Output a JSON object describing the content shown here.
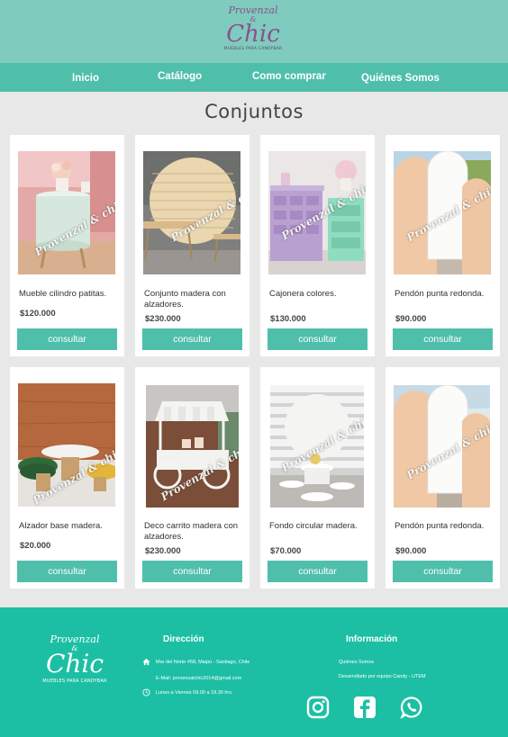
{
  "header": {
    "logo_top": "Provenzal",
    "logo_amp": "&",
    "logo_main": "Chic",
    "logo_sub": "MUEBLES PARA CANDYBAR"
  },
  "nav": {
    "items": [
      {
        "label": "Inicio"
      },
      {
        "label": "Catálogo"
      },
      {
        "label": "Como comprar"
      },
      {
        "label": "Quiénes Somos"
      }
    ]
  },
  "main": {
    "title": "Conjuntos",
    "watermark": "Provenzal & chic",
    "products": [
      {
        "name": "Mueble cilindro patitas.",
        "price": "$120.000",
        "button": "consultar"
      },
      {
        "name": "Conjunto madera con alzadores.",
        "price": "$230.000",
        "button": "consultar"
      },
      {
        "name": "Cajonera colores.",
        "price": "$130.000",
        "button": "consultar"
      },
      {
        "name": "Pendón punta redonda.",
        "price": "$90.000",
        "button": "consultar"
      },
      {
        "name": "Alzador base madera.",
        "price": "$20.000",
        "button": "consultar"
      },
      {
        "name": "Deco carrito madera con alzadores.",
        "price": "$230.000",
        "button": "consultar"
      },
      {
        "name": "Fondo circular madera.",
        "price": "$70.000",
        "button": "consultar"
      },
      {
        "name": "Pendón punta redonda.",
        "price": "$90.000",
        "button": "consultar"
      }
    ]
  },
  "footer": {
    "logo_top": "Provenzal",
    "logo_amp": "&",
    "logo_main": "Chic",
    "logo_sub": "MUEBLES PARA CANDYBAR",
    "direccion_title": "Dirección",
    "address": "Mar del Norte #58, Maipú - Santiago, Chile",
    "email": "E-Mail: provenzalchic2014@gmail.com",
    "hours": "Lunes a Viernes 09.00 a 18.30 hrs.",
    "info_title": "Información",
    "info_link": "Quiénes Somos",
    "credit": "Desarrollado por equipo Candy - UTEM",
    "social": [
      "instagram-icon",
      "facebook-icon",
      "whatsapp-icon"
    ]
  },
  "colors": {
    "header_bg": "#7fcbbe",
    "nav_bg": "#4fbfab",
    "button_bg": "#4fbfab",
    "footer_bg": "#1cbfa3",
    "logo_purple": "#8a4f8e"
  }
}
